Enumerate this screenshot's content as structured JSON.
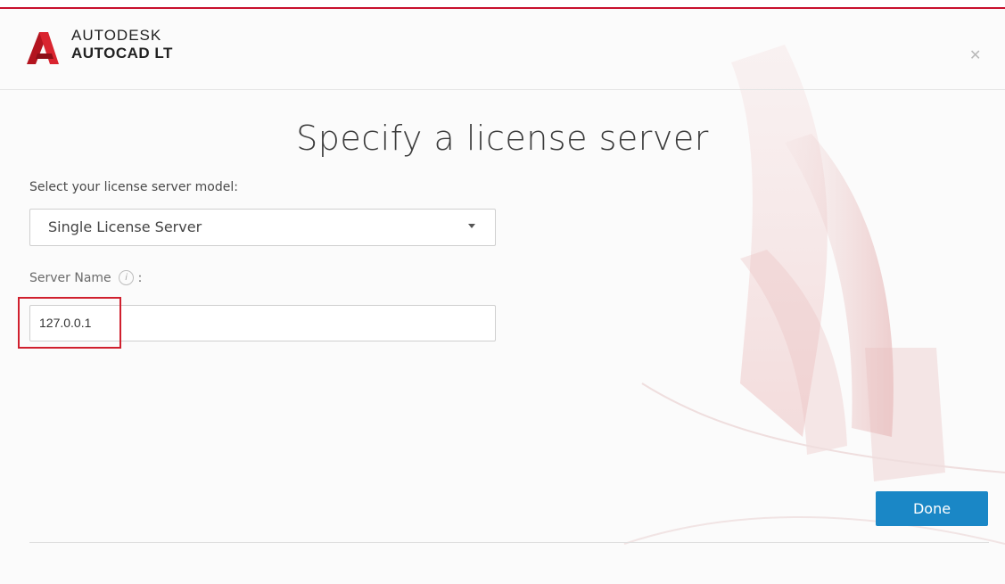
{
  "header": {
    "brand_top": "AUTODESK",
    "brand_bottom": "AUTOCAD LT",
    "close_label": "✕"
  },
  "main": {
    "title": "Specify a license server",
    "model_label": "Select your license server model:",
    "model_select": {
      "value": "Single License Server"
    },
    "server_name_label": "Server Name",
    "server_name_suffix": ":",
    "info_glyph": "i",
    "server_name_value": "127.0.0.1"
  },
  "footer": {
    "done_label": "Done"
  },
  "colors": {
    "accent_red": "#c8102e",
    "primary_button": "#1a87c6",
    "highlight_box": "#d0202e"
  },
  "icons": [
    "autocad-logo-icon",
    "close-icon",
    "info-icon",
    "dropdown-arrow-icon"
  ]
}
